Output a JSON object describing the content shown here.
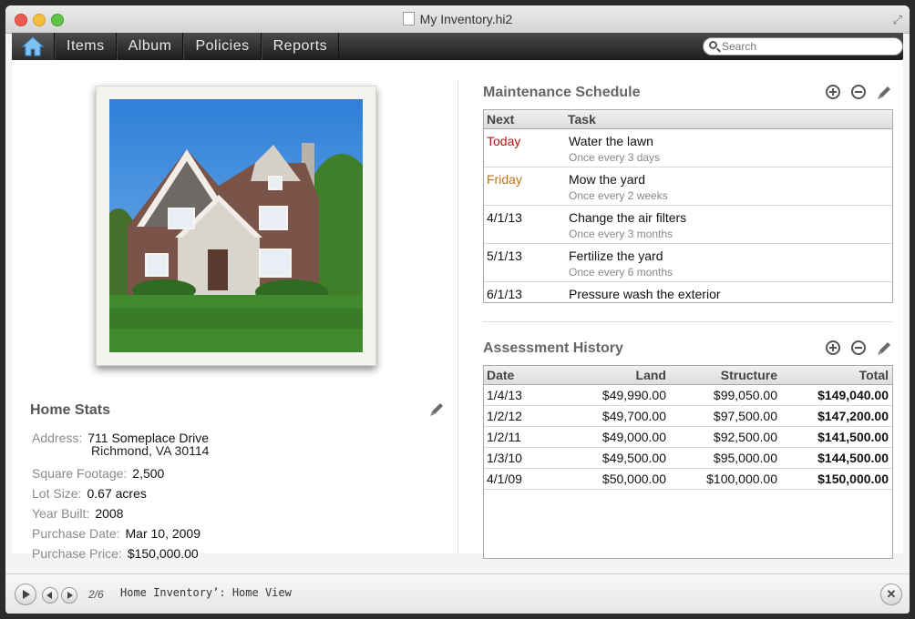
{
  "window": {
    "title": "My Inventory.hi2"
  },
  "toolbar": {
    "nav": [
      "Items",
      "Album",
      "Policies",
      "Reports"
    ],
    "search_placeholder": "Search"
  },
  "home_stats": {
    "title": "Home Stats",
    "address_label": "Address:",
    "address_line1": "711 Someplace Drive",
    "address_line2": "Richmond, VA 30114",
    "rows": [
      {
        "label": "Square Footage:",
        "value": "2,500"
      },
      {
        "label": "Lot Size:",
        "value": "0.67 acres"
      },
      {
        "label": "Year Built:",
        "value": "2008"
      },
      {
        "label": "Purchase Date:",
        "value": "Mar 10, 2009"
      },
      {
        "label": "Purchase Price:",
        "value": "$150,000.00"
      }
    ]
  },
  "maintenance": {
    "title": "Maintenance Schedule",
    "headers": {
      "next": "Next",
      "task": "Task"
    },
    "rows": [
      {
        "next": "Today",
        "next_color": "#b01a10",
        "task": "Water the lawn",
        "freq": "Once every 3 days"
      },
      {
        "next": "Friday",
        "next_color": "#b8741a",
        "task": "Mow the yard",
        "freq": "Once every 2 weeks"
      },
      {
        "next": "4/1/13",
        "next_color": "#111111",
        "task": "Change the air filters",
        "freq": "Once every 3 months"
      },
      {
        "next": "5/1/13",
        "next_color": "#111111",
        "task": "Fertilize the yard",
        "freq": "Once every 6 months"
      },
      {
        "next": "6/1/13",
        "next_color": "#111111",
        "task": "Pressure wash the exterior",
        "freq": ""
      }
    ]
  },
  "assessment": {
    "title": "Assessment History",
    "headers": {
      "date": "Date",
      "land": "Land",
      "structure": "Structure",
      "total": "Total"
    },
    "rows": [
      {
        "date": "1/4/13",
        "land": "$49,990.00",
        "structure": "$99,050.00",
        "total": "$149,040.00"
      },
      {
        "date": "1/2/12",
        "land": "$49,700.00",
        "structure": "$97,500.00",
        "total": "$147,200.00"
      },
      {
        "date": "1/2/11",
        "land": "$49,000.00",
        "structure": "$92,500.00",
        "total": "$141,500.00"
      },
      {
        "date": "1/3/10",
        "land": "$49,500.00",
        "structure": "$95,000.00",
        "total": "$144,500.00"
      },
      {
        "date": "4/1/09",
        "land": "$50,000.00",
        "structure": "$100,000.00",
        "total": "$150,000.00"
      }
    ]
  },
  "bottom": {
    "page": "2/6",
    "caption": "Home Inventory’: Home View"
  },
  "colors": {
    "sky": "#3b8ee0",
    "lawn": "#3f8a2c",
    "brick": "#7a5448"
  },
  "icons": [
    "home-icon",
    "search-icon",
    "pencil-icon",
    "add-icon",
    "remove-icon",
    "play-icon",
    "close-icon"
  ]
}
